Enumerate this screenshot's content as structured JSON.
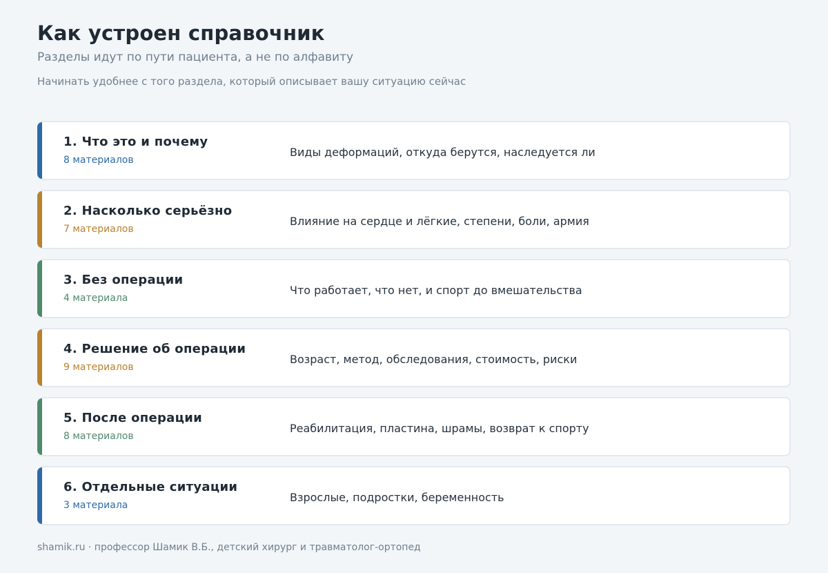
{
  "header": {
    "title": "Как устроен справочник",
    "subtitle": "Разделы идут по пути пациента, а не по алфавиту",
    "hint": "Начинать удобнее с того раздела, который описывает вашу ситуацию сейчас"
  },
  "sections": [
    {
      "title": "1. Что это и почему",
      "count": "8 материалов",
      "description": "Виды деформаций, откуда берутся, наследуется ли",
      "color": "#2f6aa8"
    },
    {
      "title": "2. Насколько серьёзно",
      "count": "7 материалов",
      "description": "Влияние на сердце и лёгкие, степени, боли, армия",
      "color": "#b8822f"
    },
    {
      "title": "3. Без операции",
      "count": "4 материала",
      "description": "Что работает, что нет, и спорт до вмешательства",
      "color": "#4e8a6a"
    },
    {
      "title": "4. Решение об операции",
      "count": "9 материалов",
      "description": "Возраст, метод, обследования, стоимость, риски",
      "color": "#b8822f"
    },
    {
      "title": "5. После операции",
      "count": "8 материалов",
      "description": "Реабилитация, пластина, шрамы, возврат к спорту",
      "color": "#4e8a6a"
    },
    {
      "title": "6. Отдельные ситуации",
      "count": "3 материала",
      "description": "Взрослые, подростки, беременность",
      "color": "#2f6aa8"
    }
  ],
  "footer": {
    "text": "shamik.ru · профессор Шамик В.Б., детский хирург и травматолог-ортопед"
  }
}
